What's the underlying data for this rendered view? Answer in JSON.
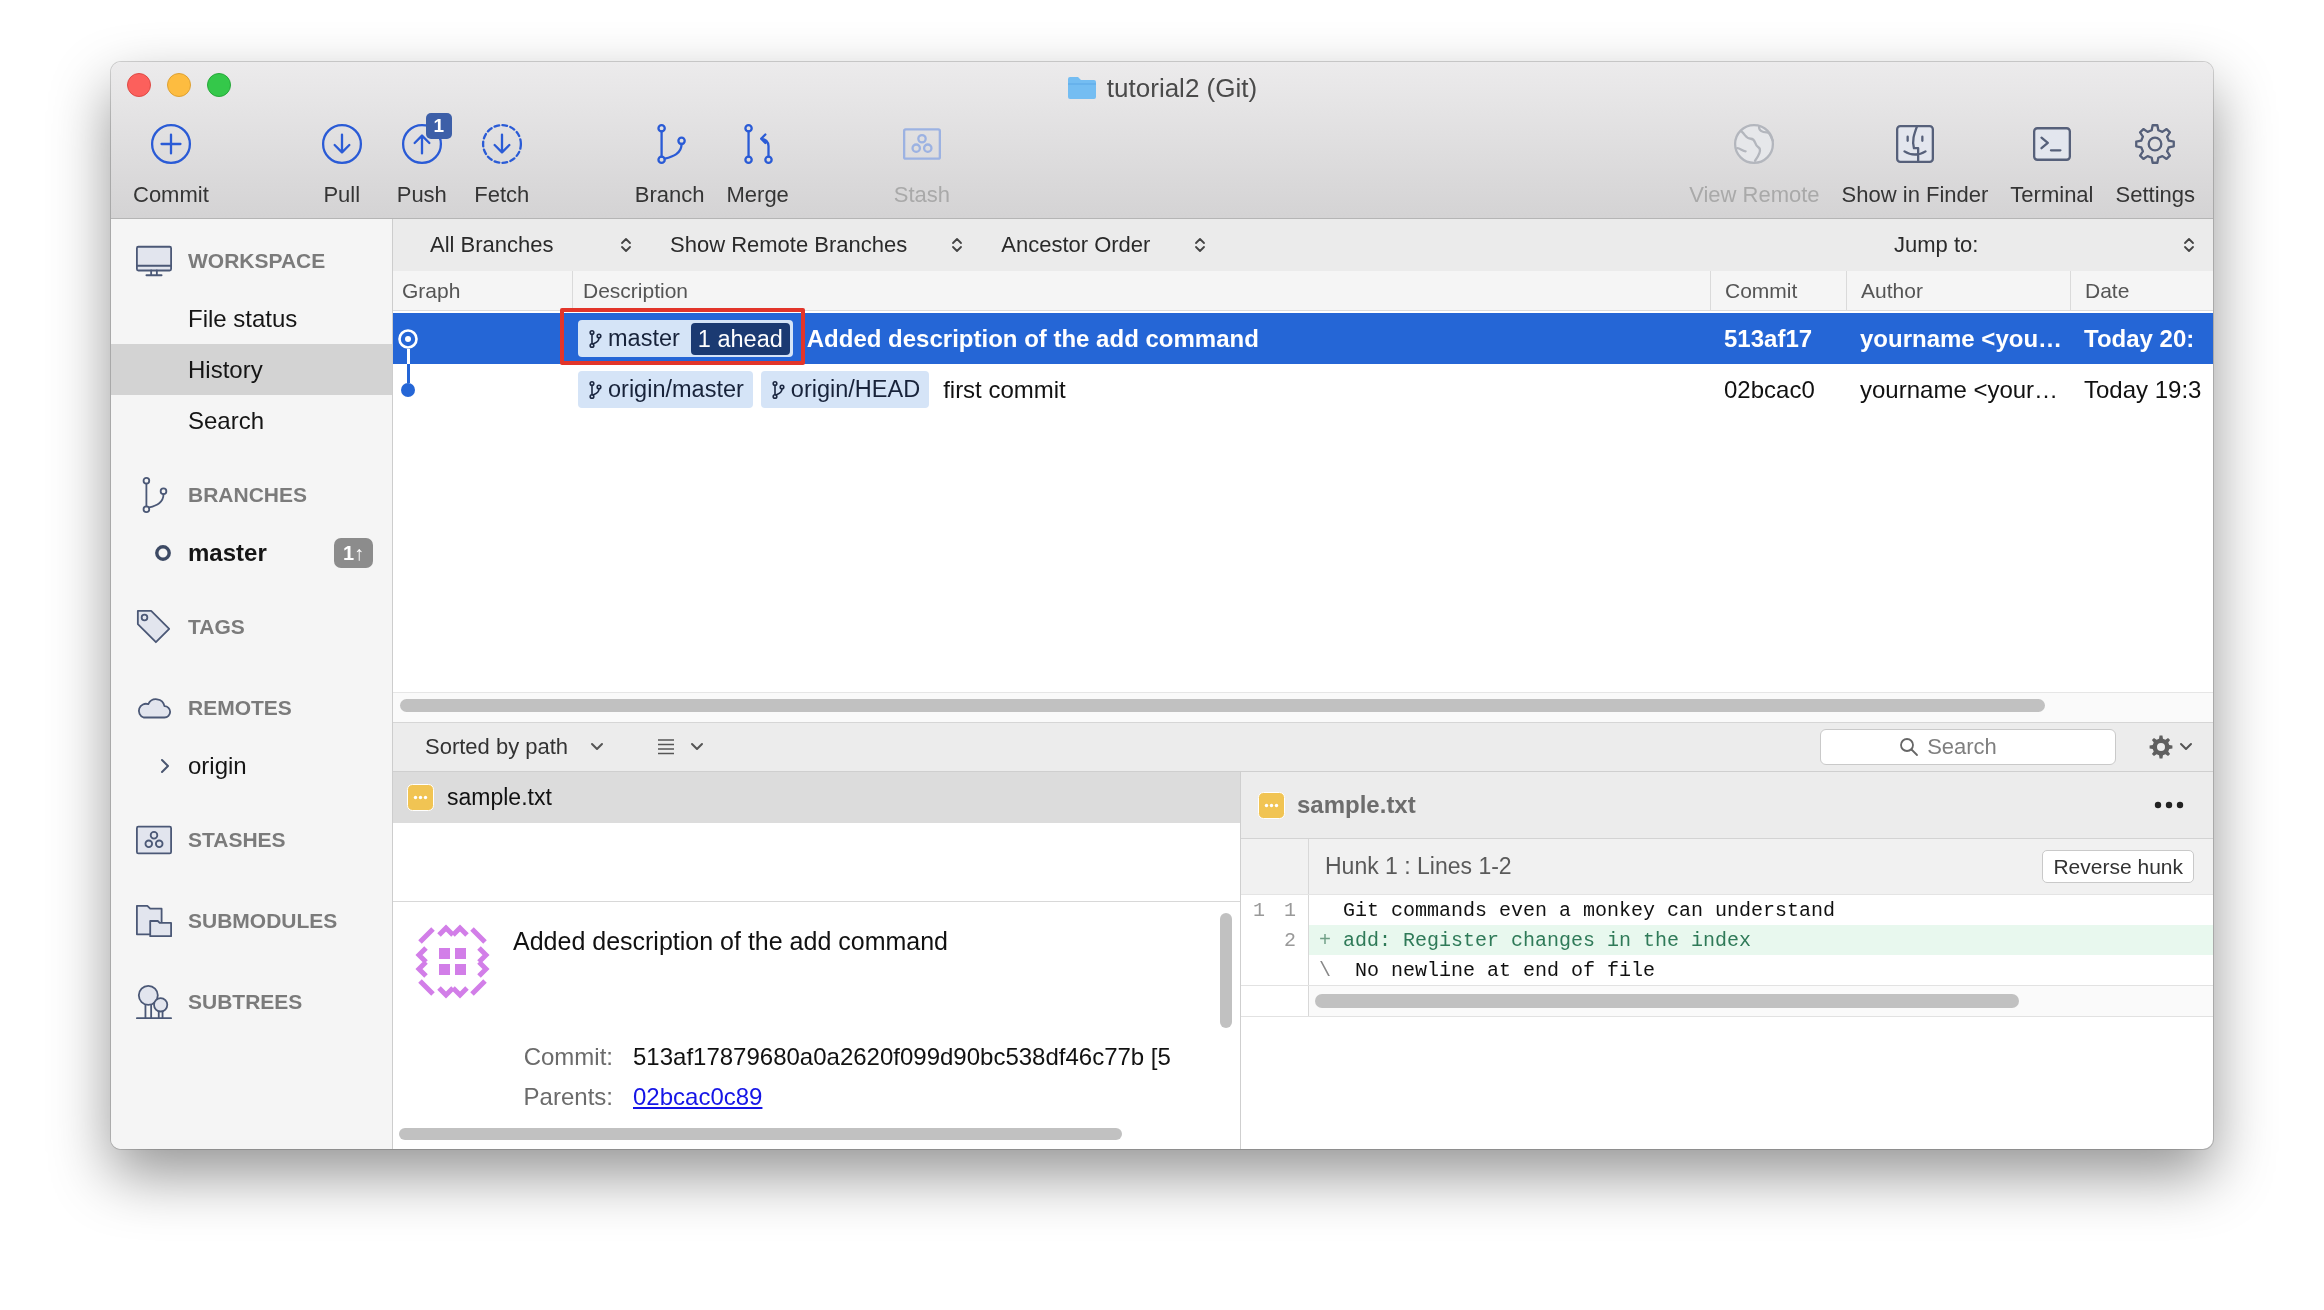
{
  "window": {
    "title": "tutorial2 (Git)"
  },
  "toolbar": {
    "groups": [
      {
        "buttons": [
          {
            "kind": "commit",
            "label": "Commit",
            "disabled": false
          }
        ]
      },
      {
        "buttons": [
          {
            "kind": "pull",
            "label": "Pull",
            "disabled": false
          },
          {
            "kind": "push",
            "label": "Push",
            "disabled": false,
            "badge": "1"
          },
          {
            "kind": "fetch",
            "label": "Fetch",
            "disabled": false
          }
        ]
      },
      {
        "buttons": [
          {
            "kind": "branch",
            "label": "Branch",
            "disabled": false
          },
          {
            "kind": "merge",
            "label": "Merge",
            "disabled": false
          }
        ]
      },
      {
        "buttons": [
          {
            "kind": "stash",
            "label": "Stash",
            "disabled": true
          }
        ]
      }
    ],
    "right_buttons": [
      {
        "kind": "view-remote",
        "label": "View Remote",
        "disabled": true
      },
      {
        "kind": "finder",
        "label": "Show in Finder",
        "disabled": false
      },
      {
        "kind": "terminal",
        "label": "Terminal",
        "disabled": false
      },
      {
        "kind": "settings",
        "label": "Settings",
        "disabled": false
      }
    ]
  },
  "sidebar": {
    "sections": [
      {
        "kind": "workspace",
        "title": "WORKSPACE",
        "items": [
          {
            "kind": "view",
            "label": "File status",
            "selected": false
          },
          {
            "kind": "view",
            "label": "History",
            "selected": true
          },
          {
            "kind": "view",
            "label": "Search",
            "selected": false
          }
        ]
      },
      {
        "kind": "branches",
        "title": "BRANCHES",
        "items": [
          {
            "kind": "branch",
            "label": "master",
            "selected": false,
            "current": true,
            "badge": "1↑"
          }
        ]
      },
      {
        "kind": "tags",
        "title": "TAGS"
      },
      {
        "kind": "remotes",
        "title": "REMOTES",
        "items": [
          {
            "kind": "remote",
            "label": "origin",
            "selected": false,
            "expanded": false
          }
        ]
      },
      {
        "kind": "stashes",
        "title": "STASHES"
      },
      {
        "kind": "submodules",
        "title": "SUBMODULES"
      },
      {
        "kind": "subtrees",
        "title": "SUBTREES"
      }
    ]
  },
  "history": {
    "filters": [
      {
        "label": "All Branches"
      },
      {
        "label": "Show Remote Branches"
      },
      {
        "label": "Ancestor Order"
      }
    ],
    "jump_to": {
      "label": "Jump to:"
    },
    "columns": [
      "Graph",
      "Description",
      "Commit",
      "Author",
      "Date"
    ],
    "rows": [
      {
        "selected": true,
        "head": true,
        "refs": [
          {
            "name": "master",
            "ahead": "1 ahead"
          }
        ],
        "refs_highlighted": true,
        "description": "Added description of the add command",
        "commit": "513af17",
        "author": "yourname <you…",
        "date": "Today 20:"
      },
      {
        "selected": false,
        "head": false,
        "refs": [
          {
            "name": "origin/master"
          },
          {
            "name": "origin/HEAD"
          }
        ],
        "refs_highlighted": false,
        "description": "first commit",
        "commit": "02bcac0",
        "author": "yourname <your…",
        "date": "Today 19:3"
      }
    ]
  },
  "files_bar": {
    "sort": {
      "label": "Sorted by path"
    },
    "search": {
      "placeholder": "Search"
    }
  },
  "files": [
    {
      "kind": "modified",
      "name": "sample.txt",
      "selected": true
    }
  ],
  "commit_details": {
    "message": "Added description of the add command",
    "fields": [
      {
        "kind": "text",
        "label": "Commit:",
        "value": "513af17879680a0a2620f099d90bc538df46c77b [5"
      },
      {
        "kind": "link",
        "label": "Parents:",
        "value": "02bcac0c89"
      }
    ]
  },
  "diff": {
    "file": {
      "kind": "modified",
      "name": "sample.txt"
    },
    "hunks": [
      {
        "title": "Hunk 1 : Lines 1-2",
        "action": "Reverse hunk",
        "lines": [
          {
            "kind": "context",
            "old": "1",
            "new": "1",
            "text": "Git commands even a monkey can understand"
          },
          {
            "kind": "added",
            "new": "2",
            "prefix": "+",
            "text": "add: Register changes in the index"
          },
          {
            "kind": "note",
            "prefix": "\\",
            "text": "No newline at end of file"
          }
        ]
      }
    ]
  }
}
